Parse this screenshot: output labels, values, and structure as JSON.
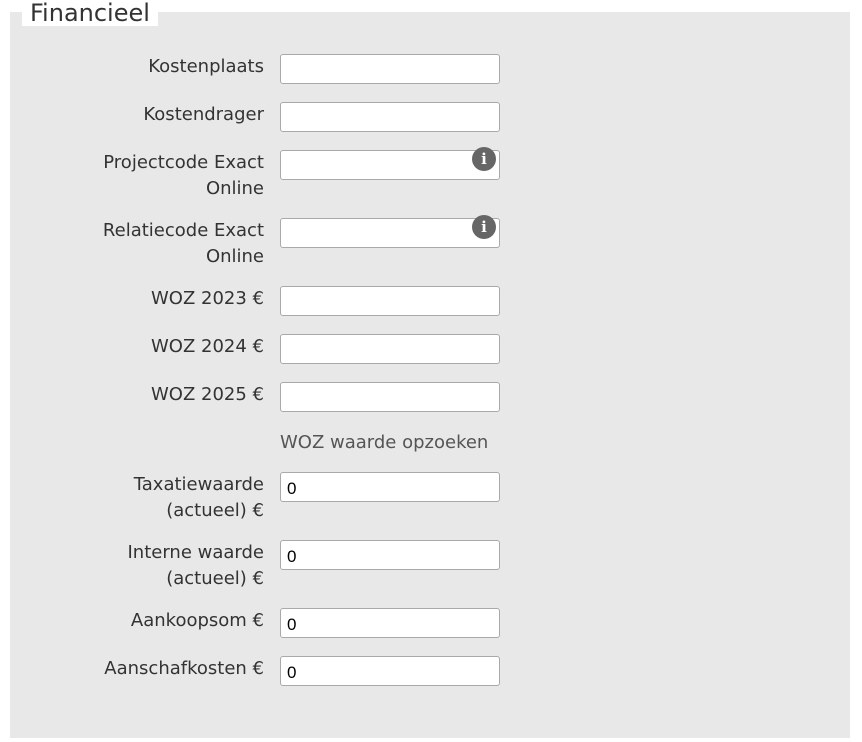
{
  "section": {
    "title": "Financieel"
  },
  "fields": {
    "kostenplaats": {
      "label": "Kostenplaats",
      "value": ""
    },
    "kostendrager": {
      "label": "Kostendrager",
      "value": ""
    },
    "projectcode": {
      "label_line1": "Projectcode Exact",
      "label_line2": "Online",
      "value": "",
      "icon": "info-icon"
    },
    "relatiecode": {
      "label_line1": "Relatiecode Exact",
      "label_line2": "Online",
      "value": "",
      "icon": "info-icon"
    },
    "woz2023": {
      "label": "WOZ 2023 €",
      "value": ""
    },
    "woz2024": {
      "label": "WOZ 2024 €",
      "value": ""
    },
    "woz2025": {
      "label": "WOZ 2025 €",
      "value": ""
    },
    "woz_link": "WOZ waarde opzoeken",
    "taxatiewaarde": {
      "label_line1": "Taxatiewaarde",
      "label_line2": "(actueel) €",
      "value": "0"
    },
    "interne_waarde": {
      "label_line1": "Interne waarde",
      "label_line2": "(actueel) €",
      "value": "0"
    },
    "aankoopsom": {
      "label": "Aankoopsom €",
      "value": "0"
    },
    "aanschafkosten": {
      "label": "Aanschafkosten €",
      "value": "0"
    }
  },
  "info_icon_glyph": "i"
}
